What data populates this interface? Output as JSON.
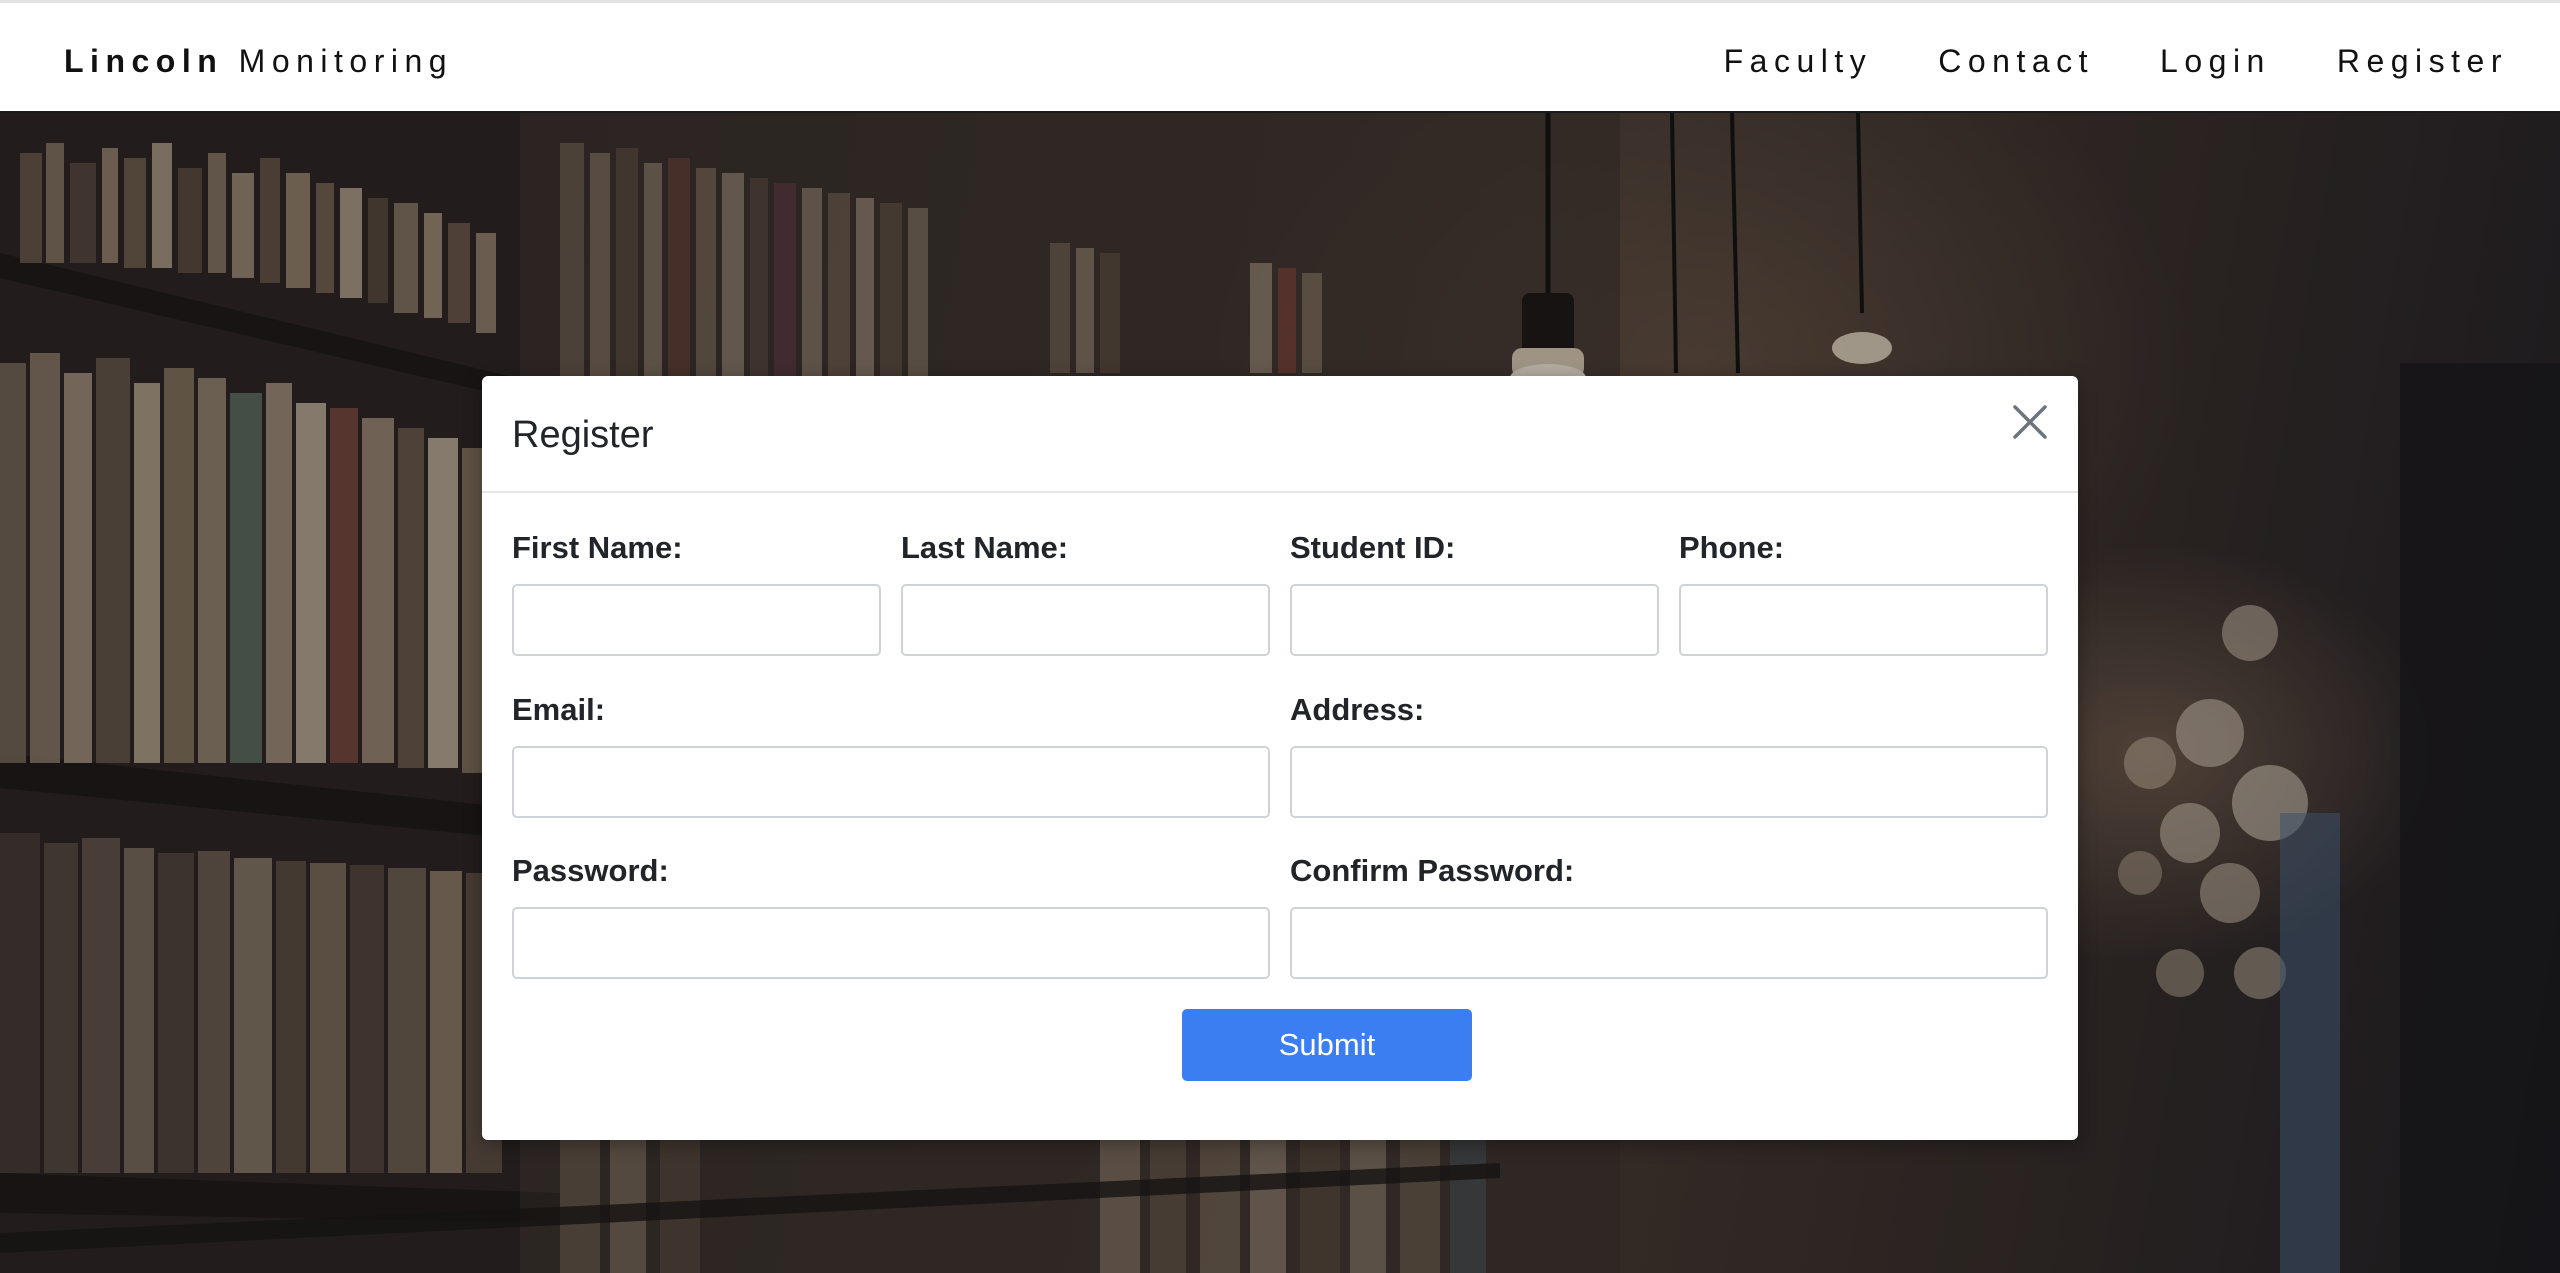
{
  "navbar": {
    "brand_bold": "Lincoln",
    "brand_light": "Monitoring",
    "links": [
      "Faculty",
      "Contact",
      "Login",
      "Register"
    ]
  },
  "modal": {
    "title": "Register",
    "close_icon": "close-icon",
    "fields": {
      "first_name": {
        "label": "First Name:",
        "value": ""
      },
      "last_name": {
        "label": "Last Name:",
        "value": ""
      },
      "student_id": {
        "label": "Student ID:",
        "value": ""
      },
      "phone": {
        "label": "Phone:",
        "value": ""
      },
      "email": {
        "label": "Email:",
        "value": ""
      },
      "address": {
        "label": "Address:",
        "value": ""
      },
      "password": {
        "label": "Password:",
        "value": ""
      },
      "confirm_password": {
        "label": "Confirm Password:",
        "value": ""
      }
    },
    "submit_label": "Submit"
  },
  "colors": {
    "accent": "#3a7ef2",
    "navbar_bg": "#ffffff",
    "modal_bg": "#ffffff"
  }
}
